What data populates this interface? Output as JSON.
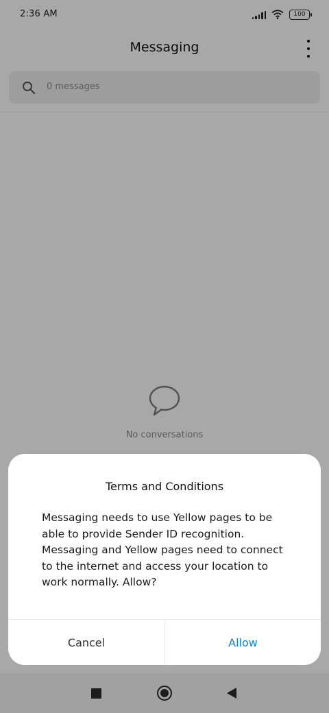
{
  "status_bar": {
    "time": "2:36 AM",
    "battery": "100",
    "icons": [
      "signal-icon",
      "wifi-icon",
      "battery-icon"
    ]
  },
  "header": {
    "title": "Messaging",
    "menu_icon": "more-vert-icon"
  },
  "search": {
    "placeholder": "0 messages",
    "icon": "search-icon"
  },
  "empty_state": {
    "icon": "chat-bubble-icon",
    "text": "No conversations"
  },
  "dialog": {
    "title": "Terms and Conditions",
    "message": "Messaging needs to use Yellow pages to be able to provide Sender ID recognition. Messaging and Yellow pages need to connect to the internet and access your location to work normally. Allow?",
    "cancel_label": "Cancel",
    "allow_label": "Allow"
  },
  "nav_bar": {
    "icons": [
      "recents-icon",
      "home-icon",
      "back-icon"
    ]
  },
  "colors": {
    "accent": "#0d84e0",
    "scrim": "#00000057"
  }
}
